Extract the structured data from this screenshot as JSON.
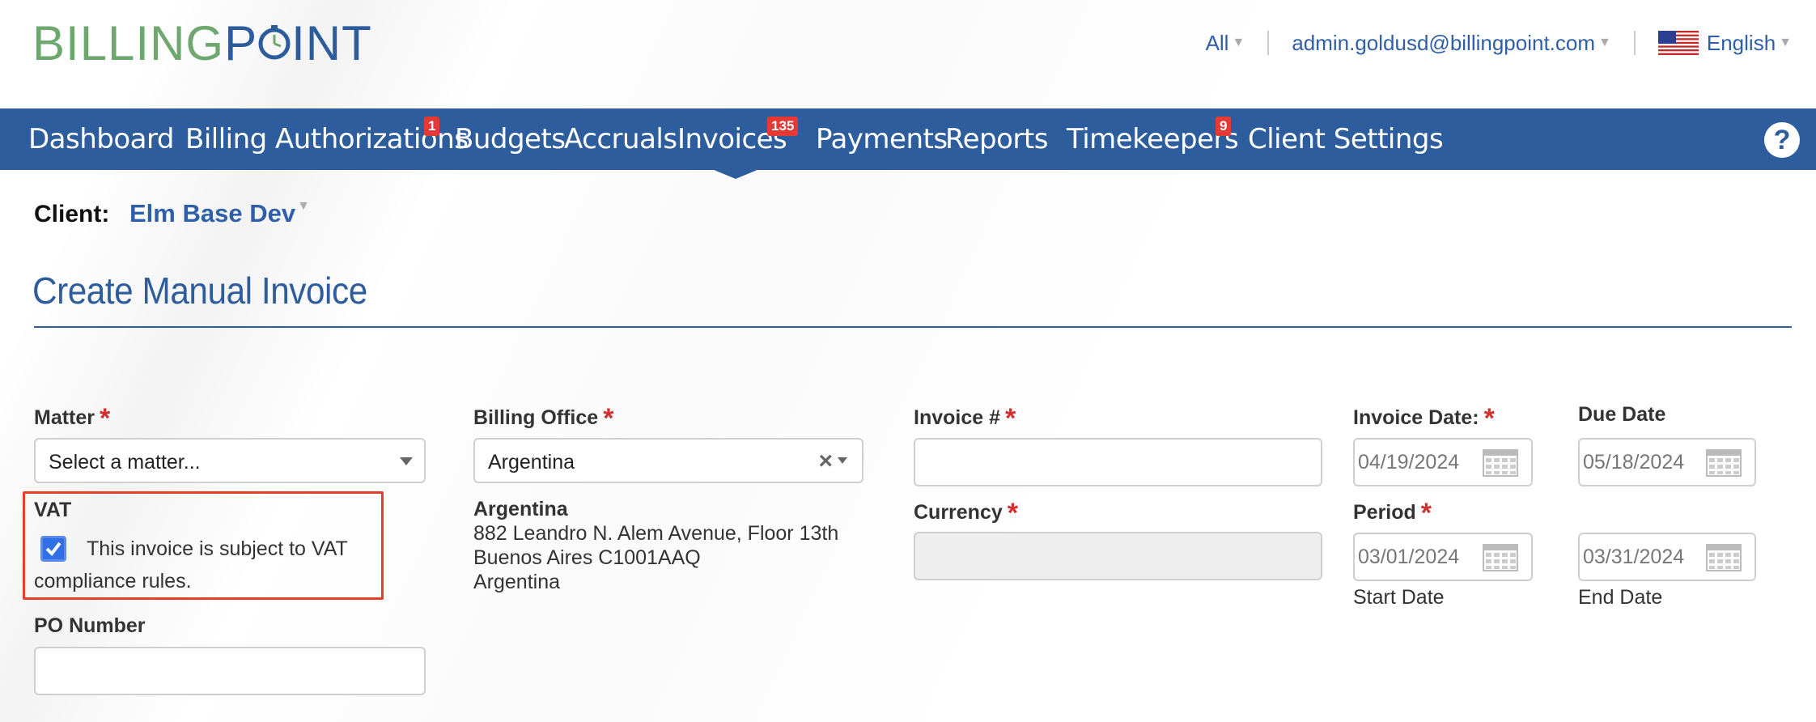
{
  "header": {
    "logo_billing": "BILLING",
    "logo_p": "P",
    "logo_int": "INT",
    "scope": "All",
    "user_email": "admin.goldusd@billingpoint.com",
    "language": "English"
  },
  "nav": {
    "items": [
      {
        "label": "Dashboard"
      },
      {
        "label": "Billing Authorizations",
        "badge": "1"
      },
      {
        "label": "Budgets"
      },
      {
        "label": "Accruals"
      },
      {
        "label": "Invoices",
        "badge": "135"
      },
      {
        "label": "Payments"
      },
      {
        "label": "Reports"
      },
      {
        "label": "Timekeepers",
        "badge": "9"
      },
      {
        "label": "Client Settings"
      }
    ],
    "help": "?"
  },
  "client": {
    "label": "Client:",
    "value": "Elm Base Dev"
  },
  "page_title": "Create Manual Invoice",
  "form": {
    "matter": {
      "label": "Matter",
      "placeholder": "Select a matter..."
    },
    "vat": {
      "label": "VAT",
      "checked": true,
      "text_line1": "This invoice is subject to VAT",
      "text_line2": "compliance rules."
    },
    "po_number": {
      "label": "PO Number",
      "value": ""
    },
    "billing_office": {
      "label": "Billing Office",
      "value": "Argentina",
      "clear": "×",
      "address_name": "Argentina",
      "address_line1": "882 Leandro N. Alem Avenue, Floor 13th",
      "address_line2": "Buenos Aires C1001AAQ",
      "address_line3": "Argentina"
    },
    "invoice_number": {
      "label": "Invoice #",
      "value": ""
    },
    "currency": {
      "label": "Currency",
      "value": ""
    },
    "invoice_date": {
      "label": "Invoice Date:",
      "value": "04/19/2024"
    },
    "due_date": {
      "label": "Due Date",
      "value": "05/18/2024"
    },
    "period": {
      "label": "Period",
      "start_value": "03/01/2024",
      "end_value": "03/31/2024",
      "start_label": "Start Date",
      "end_label": "End Date"
    }
  },
  "colors": {
    "brand_blue": "#2e5d9e",
    "brand_green": "#6fa86e",
    "badge_red": "#e53935",
    "required_red": "#d32f2f",
    "highlight_border": "#e53f2a"
  }
}
